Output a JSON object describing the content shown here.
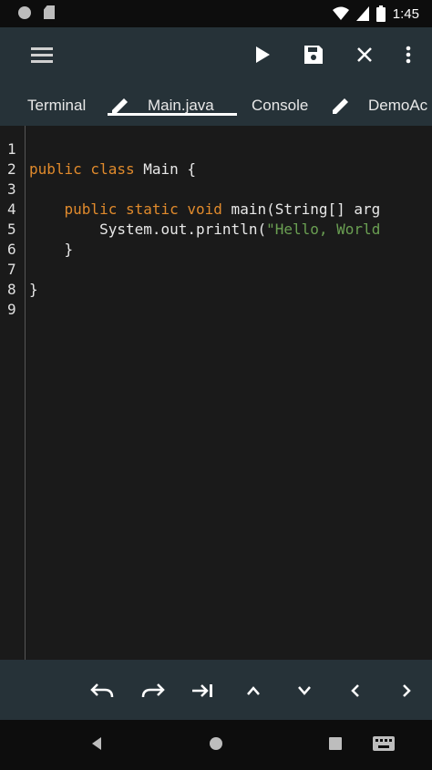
{
  "status_bar": {
    "time": "1:45"
  },
  "toolbar": {
    "menu_icon": "hamburger-icon",
    "run_icon": "play-icon",
    "save_icon": "save-icon",
    "close_icon": "close-icon",
    "more_icon": "more-vert-icon"
  },
  "tabs": [
    {
      "label": "Terminal",
      "icon": null
    },
    {
      "label": "Main.java",
      "icon": "pencil-icon",
      "active": true
    },
    {
      "label": "Console",
      "icon": null
    },
    {
      "label": "DemoAc",
      "icon": "pencil-icon"
    }
  ],
  "editor": {
    "line_numbers": [
      "1",
      "2",
      "3",
      "4",
      "5",
      "6",
      "7",
      "8",
      "9"
    ],
    "lines": [
      {
        "k1": "",
        "rest": ""
      },
      {
        "k1": "public class",
        "rest": " Main {"
      },
      {
        "k1": "",
        "rest": ""
      },
      {
        "k1": "    public static void",
        "rest": " main(String[] arg"
      },
      {
        "k1": "",
        "rest": "        System.out.println(",
        "str": "\"Hello, World"
      },
      {
        "k1": "",
        "rest": "    }"
      },
      {
        "k1": "",
        "rest": ""
      },
      {
        "k1": "",
        "rest": "}"
      },
      {
        "k1": "",
        "rest": ""
      }
    ]
  },
  "bottom_toolbar": [
    "undo-icon",
    "redo-icon",
    "tab-indent-icon",
    "arrow-up-icon",
    "arrow-down-icon",
    "arrow-left-icon",
    "arrow-right-icon"
  ],
  "colors": {
    "appbar": "#263238",
    "keyword": "#e08a2c",
    "string": "#6a9f52",
    "editor_bg": "#1a1a1a"
  }
}
